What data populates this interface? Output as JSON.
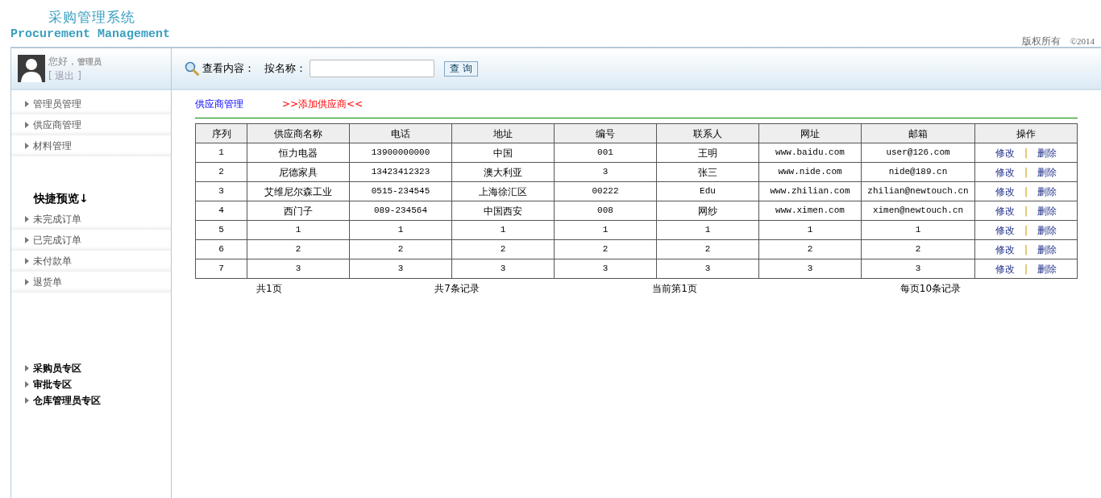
{
  "header": {
    "title_cn": "采购管理系统",
    "title_en": "Procurement Management",
    "copyright": "版权所有",
    "year": "©2014"
  },
  "user": {
    "greeting": "您好，",
    "role": "管理员",
    "logout": "[ 退出 ]"
  },
  "search": {
    "label": "查看内容：",
    "field_label": "按名称：",
    "button": "查 询"
  },
  "sidebar": {
    "menu": [
      "管理员管理",
      "供应商管理",
      "材料管理"
    ],
    "quick_title": "快捷预览↓",
    "quick_items": [
      "未完成订单",
      "已完成订单",
      "未付款单",
      "退货单"
    ],
    "zones": [
      "采购员专区",
      "审批专区",
      "仓库管理员专区"
    ]
  },
  "content": {
    "breadcrumb": "供应商管理",
    "add_link": ">>添加供应商<<",
    "table": {
      "columns": [
        "序列",
        "供应商名称",
        "电话",
        "地址",
        "编号",
        "联系人",
        "网址",
        "邮箱",
        "操作"
      ],
      "rows": [
        {
          "cells": [
            "1",
            "恒力电器",
            "13900000000",
            "中国",
            "001",
            "王明",
            "www.baidu.com",
            "user@126.com"
          ],
          "actions": [
            "修改",
            "|",
            "删除"
          ]
        },
        {
          "cells": [
            "2",
            "尼德家具",
            "13423412323",
            "澳大利亚",
            "3",
            "张三",
            "www.nide.com",
            "nide@189.cn"
          ],
          "actions": [
            "修改",
            "|",
            "删除"
          ]
        },
        {
          "cells": [
            "3",
            "艾维尼尔森工业",
            "0515-234545",
            "上海徐汇区",
            "00222",
            "Edu",
            "www.zhilian.com",
            "zhilian@newtouch.cn"
          ],
          "actions": [
            "修改",
            "|",
            "删除"
          ]
        },
        {
          "cells": [
            "4",
            "西门子",
            "089-234564",
            "中国西安",
            "008",
            "网纱",
            "www.ximen.com",
            "ximen@newtouch.cn"
          ],
          "actions": [
            "修改",
            "|",
            "删除"
          ]
        },
        {
          "cells": [
            "5",
            "1",
            "1",
            "1",
            "1",
            "1",
            "1",
            "1"
          ],
          "actions": [
            "修改",
            "|",
            "删除"
          ]
        },
        {
          "cells": [
            "6",
            "2",
            "2",
            "2",
            "2",
            "2",
            "2",
            "2"
          ],
          "actions": [
            "修改",
            "|",
            "删除"
          ]
        },
        {
          "cells": [
            "7",
            "3",
            "3",
            "3",
            "3",
            "3",
            "3",
            "3"
          ],
          "actions": [
            "修改",
            "|",
            "删除"
          ]
        }
      ]
    },
    "pagination": [
      "共1页",
      "共7条记录",
      "当前第1页",
      "每页10条记录"
    ]
  }
}
